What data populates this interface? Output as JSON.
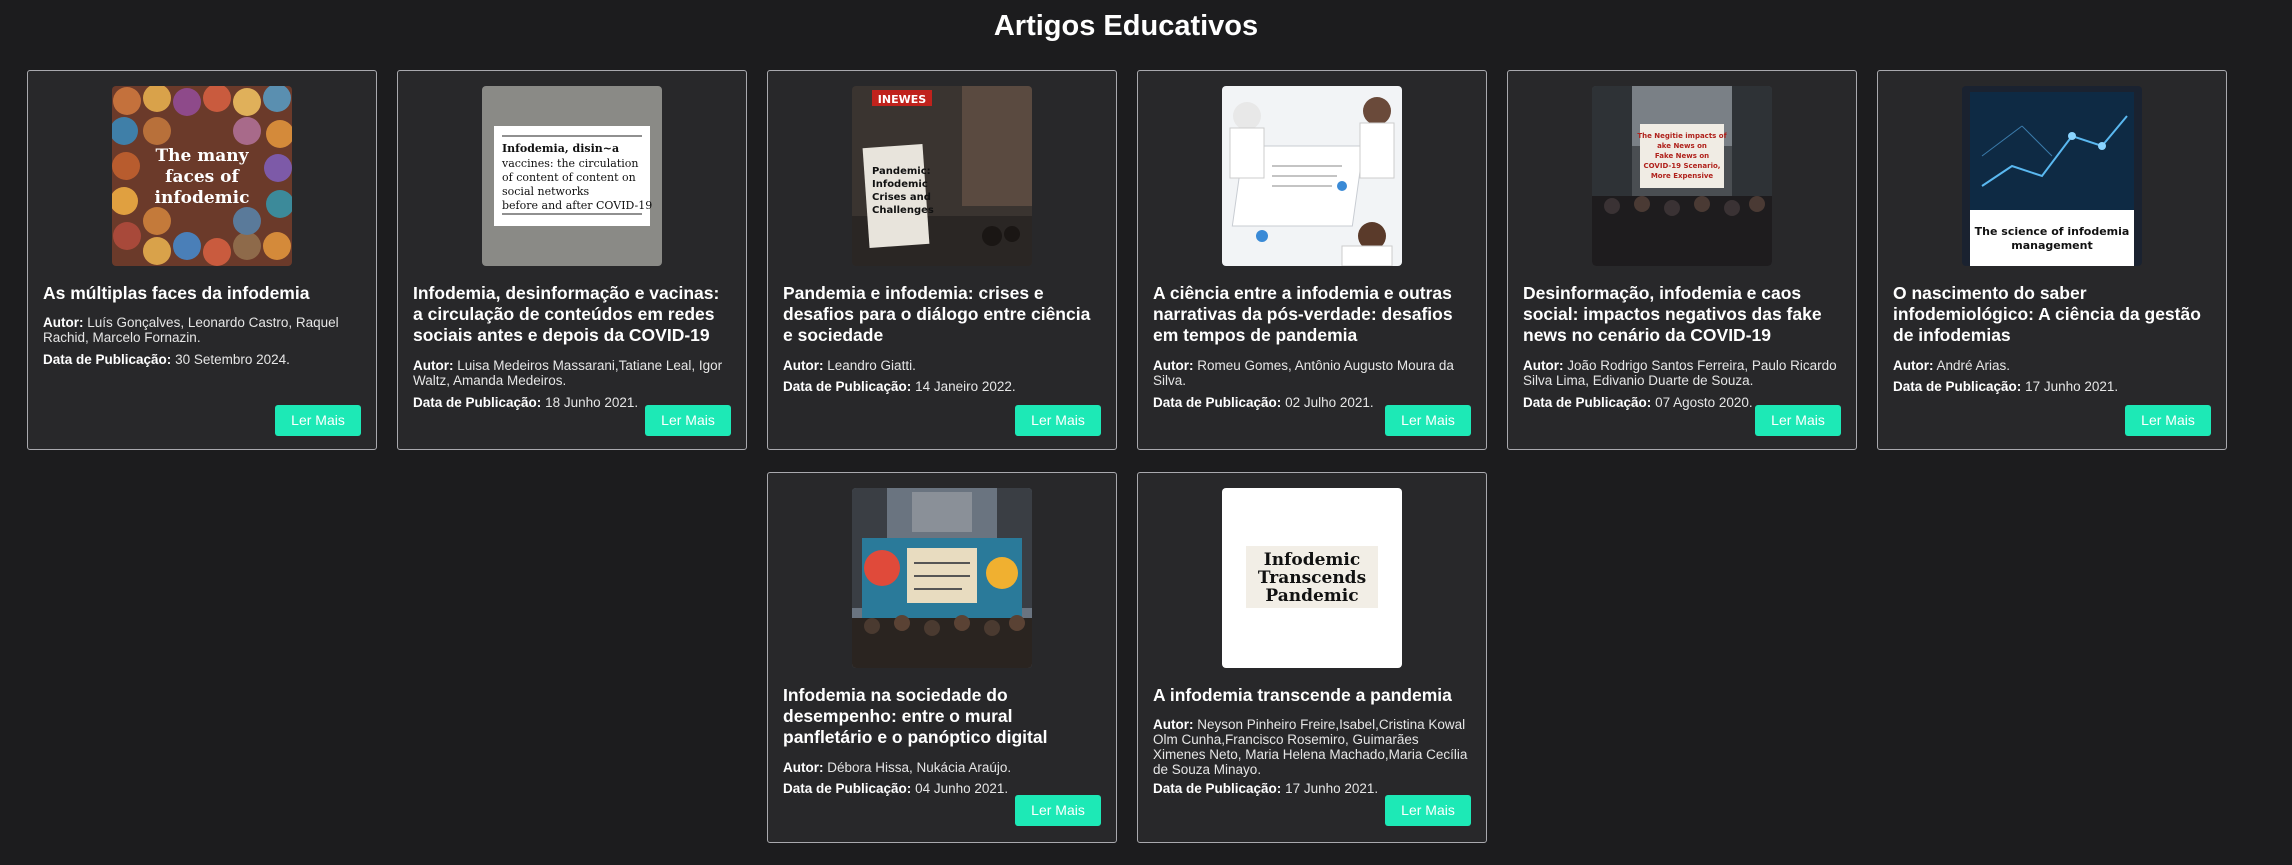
{
  "page": {
    "title": "Artigos Educativos"
  },
  "labels": {
    "author": "Autor:",
    "date": "Data de Publicação:",
    "button": "Ler Mais"
  },
  "colors": {
    "background": "#1c1c1e",
    "card": "#28282a",
    "accent": "#1de9b6"
  },
  "articles": [
    {
      "title": "As múltiplas faces da infodemia",
      "authors": "Luís Gonçalves, Leonardo Castro, Raquel Rachid, Marcelo Fornazin.",
      "date": "30 Setembro 2024.",
      "cover_text": "The many faces of infodemic"
    },
    {
      "title": "Infodemia, desinformação e vacinas: a circulação de conteúdos em redes sociais antes e depois da COVID-19",
      "authors": "Luisa Medeiros Massarani,Tatiane Leal, Igor Waltz, Amanda Medeiros.",
      "date": "18 Junho 2021.",
      "cover_text": "Infodemia, disin~a vaccines: the circulation of content of content on social networks before and after COVID-19"
    },
    {
      "title": "Pandemia e infodemia: crises e desafios para o diálogo entre ciência e sociedade",
      "authors": "Leandro Giatti.",
      "date": "14 Janeiro 2022.",
      "cover_text": "Pandemic: Infodemic Crises and Challenges"
    },
    {
      "title": "A ciência entre a infodemia e outras narrativas da pós-verdade: desafios em tempos de pandemia",
      "authors": "Romeu Gomes, Antônio Augusto Moura da Silva.",
      "date": "02 Julho 2021.",
      "cover_text": ""
    },
    {
      "title": "Desinformação, infodemia e caos social: impactos negativos das fake news no cenário da COVID-19",
      "authors": "João Rodrigo Santos Ferreira, Paulo Ricardo Silva Lima, Edivanio Duarte de Souza.",
      "date": "07 Agosto 2020.",
      "cover_text": "The Negitie impacts of ake News on Fake News on COVID-19 Scenario, More Expensive"
    },
    {
      "title": "O nascimento do saber infodemiológico: A ciência da gestão de infodemias",
      "authors": "André Arias.",
      "date": "17 Junho 2021.",
      "cover_text": "The science of infodemia management"
    },
    {
      "title": "Infodemia na sociedade do desempenho: entre o mural panfletário e o panóptico digital",
      "authors": "Débora Hissa, Nukácia Araújo.",
      "date": "04 Junho 2021.",
      "cover_text": ""
    },
    {
      "title": "A infodemia transcende a pandemia",
      "authors": "Neyson Pinheiro Freire,Isabel,Cristina Kowal Olm Cunha,Francisco Rosemiro, Guimarães Ximenes Neto, Maria Helena Machado,Maria Cecília de Souza Minayo.",
      "date": "17 Junho 2021.",
      "cover_text": "Infodemic Transcends Pandemic"
    }
  ]
}
